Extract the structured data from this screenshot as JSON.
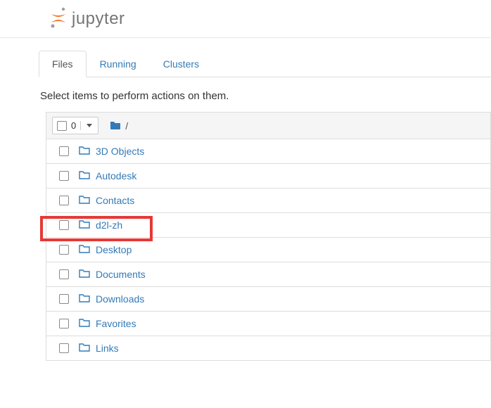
{
  "logo": {
    "text": "jupyter"
  },
  "tabs": {
    "files": "Files",
    "running": "Running",
    "clusters": "Clusters"
  },
  "actions_hint": "Select items to perform actions on them.",
  "select_all": {
    "count": "0"
  },
  "breadcrumb": {
    "separator": "/"
  },
  "items": [
    {
      "name": "3D Objects"
    },
    {
      "name": "Autodesk"
    },
    {
      "name": "Contacts"
    },
    {
      "name": "d2l-zh"
    },
    {
      "name": "Desktop"
    },
    {
      "name": "Documents"
    },
    {
      "name": "Downloads"
    },
    {
      "name": "Favorites"
    },
    {
      "name": "Links"
    }
  ]
}
